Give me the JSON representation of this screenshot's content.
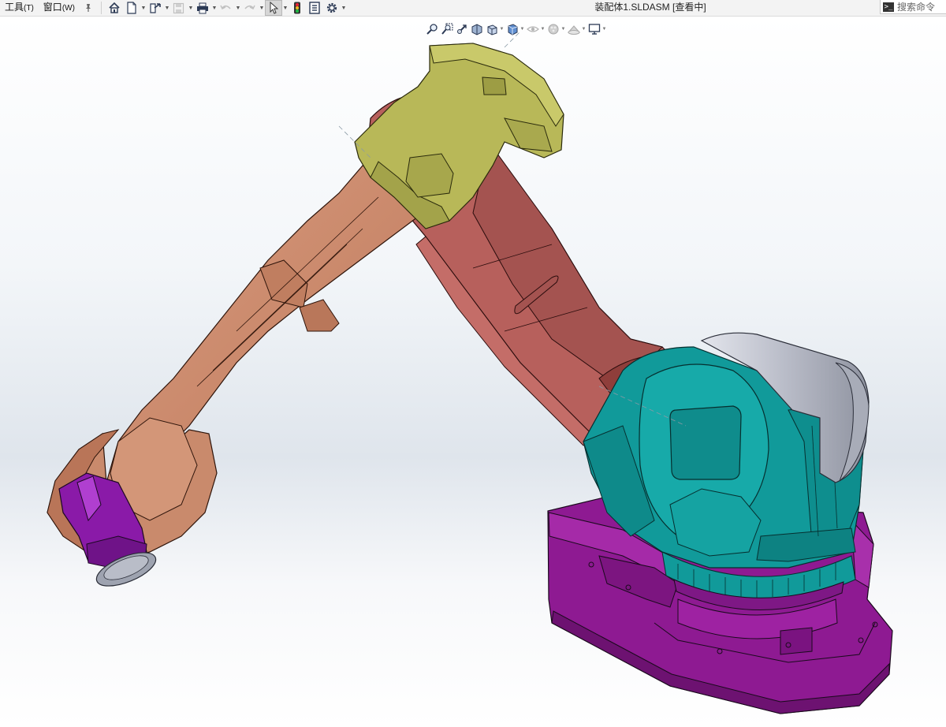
{
  "menu": {
    "tools_label": "工具",
    "tools_accel": "(T)",
    "window_label": "窗口",
    "window_accel": "(W)"
  },
  "toolbar": {
    "buttons": [
      "pin-icon",
      "home-icon",
      "new-document-icon",
      "open-icon",
      "save-icon",
      "print-icon",
      "undo-icon",
      "redo-icon",
      "select-pointer-icon",
      "traffic-light-icon",
      "file-properties-icon",
      "options-gear-icon"
    ]
  },
  "window": {
    "title": "装配体1.SLDASM [查看中]"
  },
  "search": {
    "label": "搜索命令"
  },
  "view_toolbar": {
    "buttons": [
      "zoom-to-fit-icon",
      "zoom-to-area-icon",
      "previous-view-icon",
      "section-view-icon",
      "view-orientation-icon",
      "display-style-icon",
      "hide-show-items-icon",
      "edit-appearance-icon",
      "apply-scene-icon",
      "view-settings-icon"
    ]
  },
  "colors": {
    "base": "#8e1a92",
    "turret": "#119a9a",
    "motor": "#b9bcc8",
    "lower_arm": "#b7605c",
    "upper_arm": "#c98a6c",
    "wrist_housing": "#b8b858",
    "flange": "#8a1aa8",
    "tool_plate": "#9ea3b0"
  }
}
